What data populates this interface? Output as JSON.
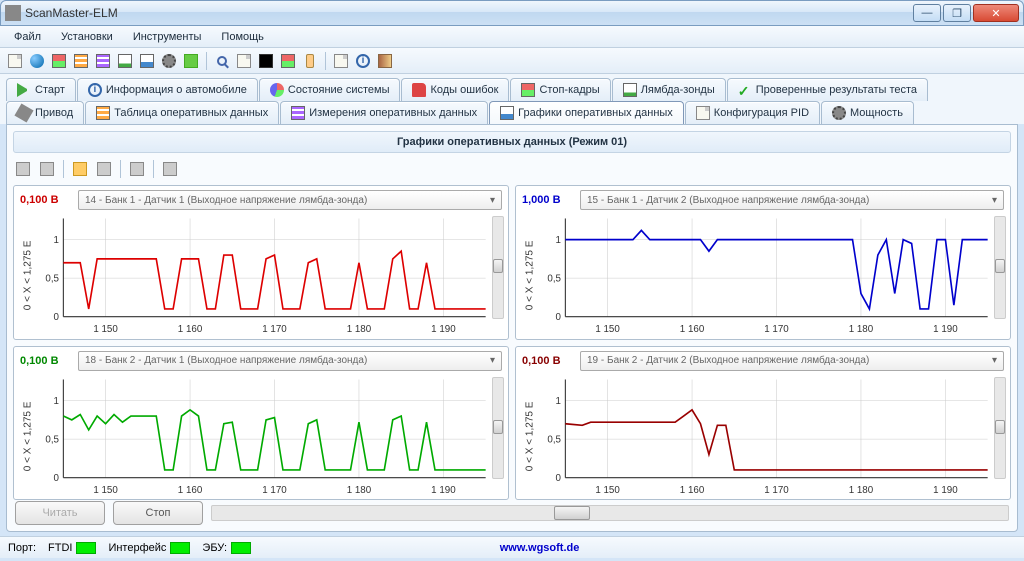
{
  "window": {
    "title": "ScanMaster-ELM"
  },
  "menu": {
    "file": "Файл",
    "settings": "Установки",
    "tools": "Инструменты",
    "help": "Помощь"
  },
  "tabs_row1": {
    "start": "Старт",
    "vehicle_info": "Информация о автомобиле",
    "system_state": "Состояние системы",
    "error_codes": "Коды ошибок",
    "freeze_frames": "Стоп-кадры",
    "lambda": "Лямбда-зонды",
    "test_results": "Проверенные результаты теста"
  },
  "tabs_row2": {
    "drive": "Привод",
    "live_table": "Таблица оперативных данных",
    "live_measure": "Измерения оперативных данных",
    "live_charts": "Графики оперативных данных",
    "pid_config": "Конфигурация PID",
    "power": "Мощность"
  },
  "panel": {
    "title": "Графики оперативных данных (Режим 01)"
  },
  "buttons": {
    "read": "Читать",
    "stop": "Стоп"
  },
  "status": {
    "port_label": "Порт:",
    "port_value": "FTDI",
    "interface_label": "Интерфейс",
    "ecu_label": "ЭБУ:",
    "link": "www.wgsoft.de"
  },
  "charts": [
    {
      "value": "0,100 В",
      "color_class": "val-red",
      "select": "14 - Банк 1 - Датчик 1 (Выходное напряжение лямбда-зонда)",
      "line_color": "#d00"
    },
    {
      "value": "1,000 В",
      "color_class": "val-blue",
      "select": "15 - Банк 1 - Датчик 2 (Выходное напряжение лямбда-зонда)",
      "line_color": "#00c"
    },
    {
      "value": "0,100 В",
      "color_class": "val-green",
      "select": "18 - Банк 2 - Датчик 1 (Выходное напряжение лямбда-зонда)",
      "line_color": "#0a0"
    },
    {
      "value": "0,100 В",
      "color_class": "val-maroon",
      "select": "19 - Банк 2 - Датчик 2 (Выходное напряжение лямбда-зонда)",
      "line_color": "#900"
    }
  ],
  "chart_data": [
    {
      "type": "line",
      "title": "",
      "xlabel": "",
      "ylabel": "0 < X < 1,275 E",
      "xlim": [
        1145,
        1195
      ],
      "ylim": [
        0,
        1.275
      ],
      "xticks": [
        1150,
        1160,
        1170,
        1180,
        1190
      ],
      "yticks": [
        0,
        0.5,
        1
      ],
      "series": [
        {
          "name": "Bank1 Sensor1",
          "color": "#d00",
          "points": [
            [
              1145,
              0.7
            ],
            [
              1147,
              0.7
            ],
            [
              1148,
              0.1
            ],
            [
              1149,
              0.75
            ],
            [
              1156,
              0.75
            ],
            [
              1157,
              0.1
            ],
            [
              1158,
              0.1
            ],
            [
              1159,
              0.75
            ],
            [
              1161,
              0.75
            ],
            [
              1162,
              0.1
            ],
            [
              1163,
              0.1
            ],
            [
              1164,
              0.8
            ],
            [
              1165,
              0.8
            ],
            [
              1166,
              0.1
            ],
            [
              1168,
              0.1
            ],
            [
              1169,
              0.75
            ],
            [
              1170,
              0.8
            ],
            [
              1171,
              0.1
            ],
            [
              1173,
              0.1
            ],
            [
              1174,
              0.7
            ],
            [
              1175,
              0.75
            ],
            [
              1176,
              0.1
            ],
            [
              1179,
              0.1
            ],
            [
              1180,
              0.7
            ],
            [
              1181,
              0.1
            ],
            [
              1183,
              0.1
            ],
            [
              1184,
              0.75
            ],
            [
              1185,
              0.85
            ],
            [
              1186,
              0.1
            ],
            [
              1187,
              0.1
            ],
            [
              1188,
              0.7
            ],
            [
              1189,
              0.1
            ],
            [
              1195,
              0.1
            ]
          ]
        }
      ]
    },
    {
      "type": "line",
      "title": "",
      "xlabel": "",
      "ylabel": "0 < X < 1,275 E",
      "xlim": [
        1145,
        1195
      ],
      "ylim": [
        0,
        1.275
      ],
      "xticks": [
        1150,
        1160,
        1170,
        1180,
        1190
      ],
      "yticks": [
        0,
        0.5,
        1
      ],
      "series": [
        {
          "name": "Bank1 Sensor2",
          "color": "#00c",
          "points": [
            [
              1145,
              1.0
            ],
            [
              1152,
              1.0
            ],
            [
              1153,
              1.0
            ],
            [
              1154,
              1.12
            ],
            [
              1155,
              1.0
            ],
            [
              1161,
              1.0
            ],
            [
              1162,
              0.85
            ],
            [
              1163,
              1.0
            ],
            [
              1179,
              1.0
            ],
            [
              1180,
              0.3
            ],
            [
              1181,
              0.1
            ],
            [
              1182,
              0.8
            ],
            [
              1183,
              1.0
            ],
            [
              1184,
              0.3
            ],
            [
              1185,
              1.0
            ],
            [
              1186,
              0.95
            ],
            [
              1187,
              0.1
            ],
            [
              1188,
              0.1
            ],
            [
              1189,
              1.0
            ],
            [
              1190,
              1.0
            ],
            [
              1191,
              0.15
            ],
            [
              1192,
              1.0
            ],
            [
              1195,
              1.0
            ]
          ]
        }
      ]
    },
    {
      "type": "line",
      "title": "",
      "xlabel": "",
      "ylabel": "0 < X < 1,275 E",
      "xlim": [
        1145,
        1195
      ],
      "ylim": [
        0,
        1.275
      ],
      "xticks": [
        1150,
        1160,
        1170,
        1180,
        1190
      ],
      "yticks": [
        0,
        0.5,
        1
      ],
      "series": [
        {
          "name": "Bank2 Sensor1",
          "color": "#0a0",
          "points": [
            [
              1145,
              0.8
            ],
            [
              1146,
              0.75
            ],
            [
              1147,
              0.82
            ],
            [
              1148,
              0.62
            ],
            [
              1149,
              0.8
            ],
            [
              1150,
              0.7
            ],
            [
              1151,
              0.82
            ],
            [
              1152,
              0.72
            ],
            [
              1153,
              0.8
            ],
            [
              1156,
              0.8
            ],
            [
              1157,
              0.1
            ],
            [
              1158,
              0.1
            ],
            [
              1159,
              0.8
            ],
            [
              1160,
              0.88
            ],
            [
              1161,
              0.8
            ],
            [
              1162,
              0.1
            ],
            [
              1163,
              0.1
            ],
            [
              1164,
              0.7
            ],
            [
              1165,
              0.72
            ],
            [
              1166,
              0.1
            ],
            [
              1168,
              0.1
            ],
            [
              1169,
              0.75
            ],
            [
              1170,
              0.78
            ],
            [
              1171,
              0.1
            ],
            [
              1173,
              0.1
            ],
            [
              1174,
              0.7
            ],
            [
              1175,
              0.75
            ],
            [
              1176,
              0.1
            ],
            [
              1179,
              0.1
            ],
            [
              1180,
              0.72
            ],
            [
              1181,
              0.1
            ],
            [
              1183,
              0.1
            ],
            [
              1184,
              0.75
            ],
            [
              1185,
              0.8
            ],
            [
              1186,
              0.1
            ],
            [
              1187,
              0.1
            ],
            [
              1188,
              0.72
            ],
            [
              1189,
              0.1
            ],
            [
              1195,
              0.1
            ]
          ]
        }
      ]
    },
    {
      "type": "line",
      "title": "",
      "xlabel": "",
      "ylabel": "0 < X < 1,275 E",
      "xlim": [
        1145,
        1195
      ],
      "ylim": [
        0,
        1.275
      ],
      "xticks": [
        1150,
        1160,
        1170,
        1180,
        1190
      ],
      "yticks": [
        0,
        0.5,
        1
      ],
      "series": [
        {
          "name": "Bank2 Sensor2",
          "color": "#900",
          "points": [
            [
              1145,
              0.7
            ],
            [
              1147,
              0.68
            ],
            [
              1148,
              0.72
            ],
            [
              1157,
              0.72
            ],
            [
              1158,
              0.72
            ],
            [
              1159,
              0.8
            ],
            [
              1160,
              0.88
            ],
            [
              1161,
              0.7
            ],
            [
              1162,
              0.3
            ],
            [
              1163,
              0.68
            ],
            [
              1164,
              0.68
            ],
            [
              1165,
              0.1
            ],
            [
              1195,
              0.1
            ]
          ]
        }
      ]
    }
  ]
}
